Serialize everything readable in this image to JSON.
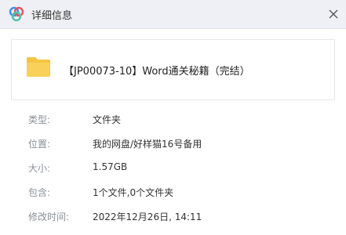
{
  "window": {
    "title": "详细信息",
    "logo_icon": "baidu-netdisk-cloud-icon",
    "close_icon": "close-icon",
    "accent_colors": [
      "#e8545a",
      "#3b8ff3",
      "#4fc3a5"
    ]
  },
  "file": {
    "icon": "folder-icon",
    "icon_color": "#f5c542",
    "name": "【JP00073-10】Word通关秘籍（完结）"
  },
  "details": [
    {
      "label": "类型:",
      "value": "文件夹"
    },
    {
      "label": "位置:",
      "value": "我的网盘/好样猫16号备用"
    },
    {
      "label": "大小:",
      "value": "1.57GB"
    },
    {
      "label": "包含:",
      "value": "1个文件,0个文件夹"
    },
    {
      "label": "修改时间:",
      "value": "2022年12月26日, 14:11"
    }
  ]
}
